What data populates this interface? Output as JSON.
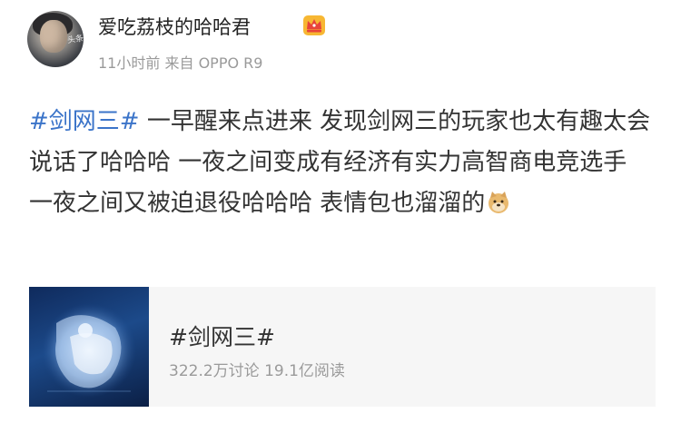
{
  "post": {
    "username": "爱吃荔枝的哈哈君",
    "time": "11小时前",
    "source_prefix": "来自",
    "source": "OPPO R9",
    "avatar_watermark": "头条",
    "badge_icon": "crown-badge-icon",
    "content": {
      "hashtag": "#剑网三#",
      "text": " 一早醒来点进来 发现剑网三的玩家也太有趣太会说话了哈哈哈 一夜之间变成有经济有实力高智商电竞选手 一夜之间又被迫退役哈哈哈 表情包也溜溜的",
      "emoji": "doge-emoji-icon"
    },
    "topic_card": {
      "title": "#剑网三#",
      "discussions": "322.2万讨论",
      "reads": "19.1亿阅读"
    }
  },
  "colors": {
    "link": "#3b74c9",
    "meta_gray": "#9a9a9a",
    "card_bg": "#f6f6f6",
    "text": "#333333"
  }
}
